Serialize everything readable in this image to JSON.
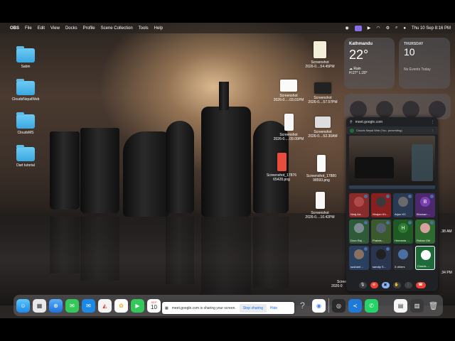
{
  "menubar": {
    "app_name": "OBS",
    "items": [
      "File",
      "Edit",
      "View",
      "Docks",
      "Profile",
      "Scene Collection",
      "Tools",
      "Help"
    ],
    "datetime": "Thu 10 Sep  8:16 PM"
  },
  "desktop": {
    "folders": [
      {
        "label": "Sabin"
      },
      {
        "label": "CloudsNepalWeb"
      },
      {
        "label": "CloudsMS"
      },
      {
        "label": "Dart tutorial"
      }
    ],
    "screenshots": [
      {
        "line1": "Screenshot",
        "line2": "2026-0....54.45PM"
      },
      {
        "line1": "Screenshot",
        "line2": "2026-0.....03.01PM"
      },
      {
        "line1": "Screenshot",
        "line2": "2026-0....57.57PM"
      },
      {
        "line1": "Screenshot",
        "line2": "2026-0.....09.09PM"
      },
      {
        "line1": "Screenshot",
        "line2": "2026-0....52.30AM"
      },
      {
        "line1": "Screenshot_17876",
        "line2": "65428.png"
      },
      {
        "line1": "Screenshot_17880",
        "line2": "98593.png"
      },
      {
        "line1": "Screenshot",
        "line2": "2026-0....10.42PM"
      }
    ],
    "partial_labels": [
      "Scree",
      "2026-0",
      ".38 AM",
      ".34 PM"
    ]
  },
  "widgets": {
    "weather": {
      "city": "Kathmandu",
      "temp": "22°",
      "condition": "Rain",
      "hilo": "H:27° L:20°"
    },
    "calendar": {
      "dow": "THURSDAY",
      "day": "10",
      "events": "No Events Today"
    }
  },
  "meet": {
    "url": "meet.google.com",
    "tab_title": "Clouds Nepal Web (You, presenting)",
    "participants": [
      {
        "name": "Niraj Ad...",
        "initial": "",
        "color": "#8a2b2b"
      },
      {
        "name": "Nirajan Kh...",
        "initial": "",
        "color": "#8a1f1f"
      },
      {
        "name": "Arjun KC",
        "initial": "",
        "color": "#2a3a55"
      },
      {
        "name": "Bhuwan ...",
        "initial": "B",
        "color": "#7b3fb5"
      },
      {
        "name": "Dron Raj ...",
        "initial": "",
        "color": "#2e5a3a"
      },
      {
        "name": "Prabes...",
        "initial": "",
        "color": "#3a5a2e"
      },
      {
        "name": "Hemanta ...",
        "initial": "H",
        "color": "#2e7d32"
      },
      {
        "name": "Rohan Giri",
        "initial": "",
        "color": "#2e6b2e"
      },
      {
        "name": "sushant ...",
        "initial": "",
        "color": "#2a4060"
      },
      {
        "name": "sandip S...",
        "initial": "",
        "color": "#2a3550"
      },
      {
        "name": "3 others",
        "initial": "",
        "color": "#2a2c33"
      },
      {
        "name": "Clouds ...",
        "initial": "",
        "color": "#1e6b3a"
      }
    ]
  },
  "sharebar": {
    "message": "meet.google.com is sharing your screen.",
    "stop_label": "Stop sharing",
    "hide_label": "Hide"
  },
  "dock": {
    "calendar_day": "10",
    "calendar_month": "SEP"
  }
}
